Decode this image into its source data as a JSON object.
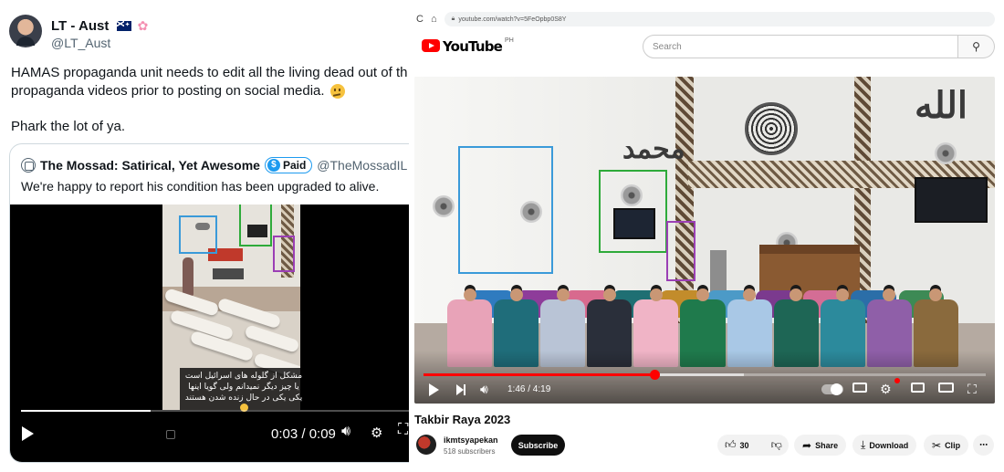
{
  "tweet": {
    "display_name": "LT - Aust",
    "handle": "@LT_Aust",
    "line1": "HAMAS propaganda unit needs to edit all the living dead out of th",
    "line2": "propaganda videos prior to posting on social media.",
    "line3": "Phark the lot of ya.",
    "quote": {
      "name": "The Mossad: Satirical, Yet Awesome",
      "badge_symbol": "$",
      "badge": "Paid",
      "handle": "@TheMossadIL · Nov",
      "text": "We're happy to report his condition has been upgraded to alive.",
      "caption": "مشکل از گلوله های اسرائیل است یا چیز دیگر نمیدانم ولی گویا اینها یکی یکی در حال زنده شدن هستند",
      "video_time": "0:03 / 0:09",
      "progress_fraction": 0.33
    },
    "box_colors": {
      "blue": "#3a9ad9",
      "green": "#2eaa3a",
      "purple": "#9b3fb5"
    }
  },
  "youtube": {
    "url": "youtube.com/watch?v=5FeOpbp0S8Y",
    "nav_back": "C",
    "nav_home": "⌂",
    "logo_text": "YouTube",
    "country": "PH",
    "search_placeholder": "Search",
    "time": "1:46 / 4:19",
    "progress_fraction": 0.41,
    "buffer_fraction": 0.57,
    "calligraphy_left": "محمد",
    "calligraphy_right": "الله",
    "video_title": "Takbir Raya 2023",
    "channel_name": "ikmtsyapekan",
    "subscribers": "518 subscribers",
    "subscribe_label": "Subscribe",
    "like_count": "30",
    "share_label": "Share",
    "download_label": "Download",
    "clip_label": "Clip",
    "accent_color": "#ff0000"
  }
}
